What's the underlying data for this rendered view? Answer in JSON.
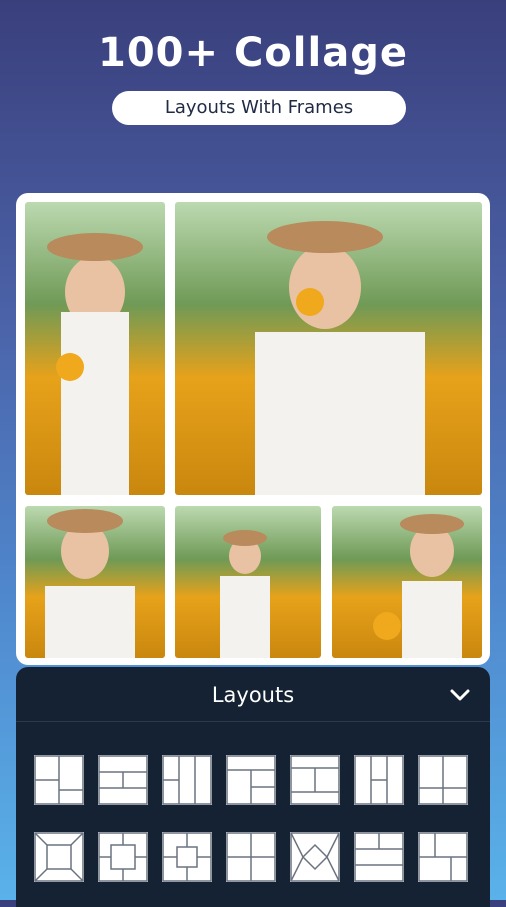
{
  "header": {
    "title": "100+ Collage",
    "subtitle": "Layouts With Frames"
  },
  "panel": {
    "title": "Layouts"
  },
  "icons": {
    "collapse": "chevron-down-icon"
  },
  "colors": {
    "panel_bg": "#152233",
    "accent": "#e7a21a"
  }
}
